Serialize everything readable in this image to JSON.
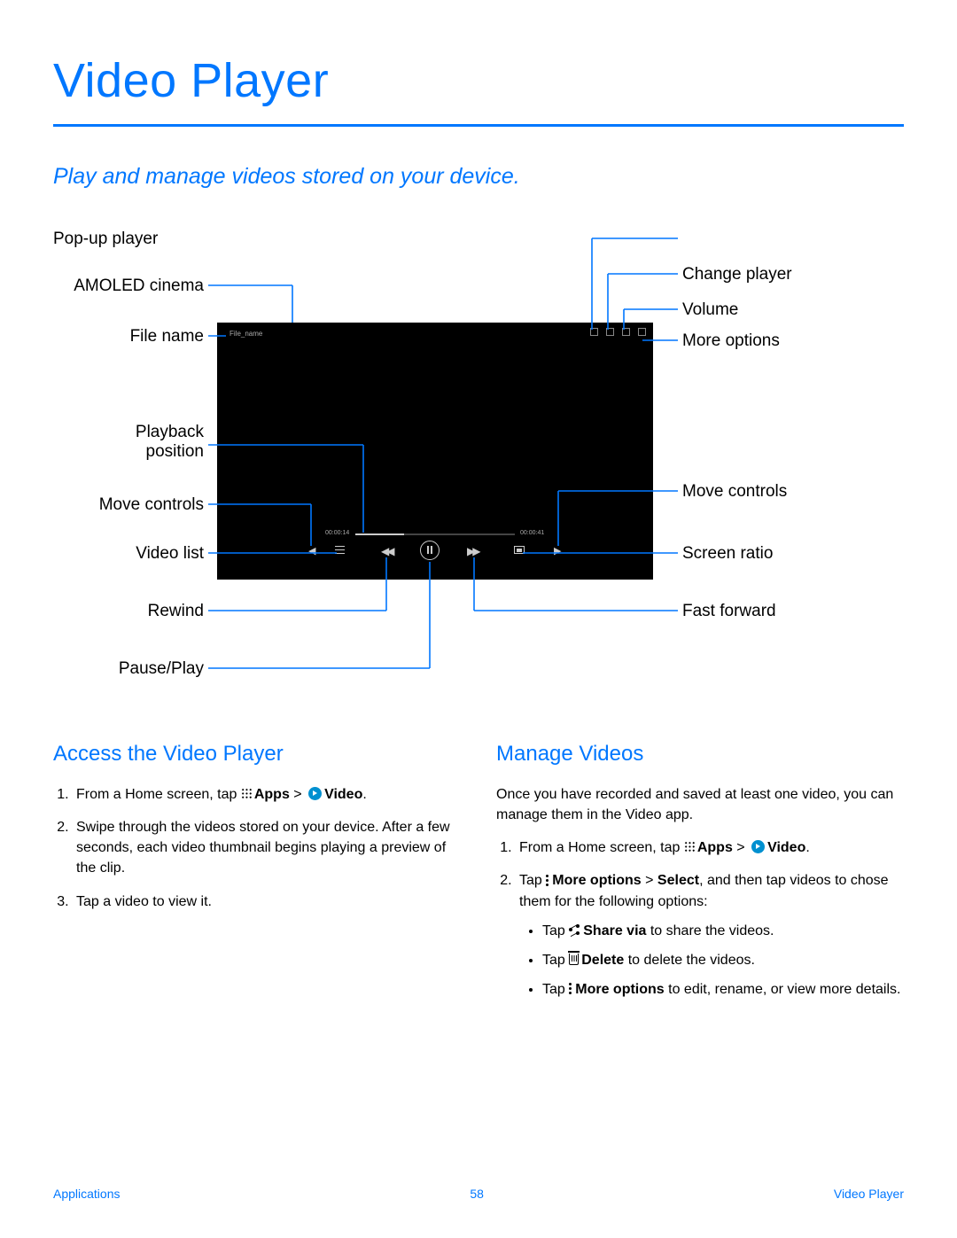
{
  "title": "Video Player",
  "subtitle": "Play and manage videos stored on your device.",
  "labels": {
    "amoled": "AMOLED cinema",
    "filename": "File name",
    "playback": "Playback\nposition",
    "move_left": "Move controls",
    "video_list": "Video list",
    "rewind": "Rewind",
    "pauseplay": "Pause/Play",
    "popup": "Pop-up player",
    "change": "Change player",
    "volume": "Volume",
    "more": "More options",
    "move_right": "Move controls",
    "ratio": "Screen ratio",
    "ffwd": "Fast forward"
  },
  "screenshot": {
    "file_label": "File_name",
    "t1": "00:00:14",
    "t2": "00:00:41"
  },
  "sections": {
    "access": {
      "heading": "Access the Video Player",
      "step1_a": "From a Home screen, tap ",
      "step1_apps": "Apps",
      "step1_gt": " > ",
      "step1_video": "Video",
      "step1_end": ".",
      "step2": "Swipe through the videos stored on your device. After a few seconds, each video thumbnail begins playing a preview of the clip.",
      "step3": "Tap a video to view it."
    },
    "manage": {
      "heading": "Manage Videos",
      "intro": "Once you have recorded and saved at least one video, you can manage them in the Video app.",
      "step1_a": "From a Home screen, tap ",
      "step1_apps": "Apps",
      "step1_gt": " > ",
      "step1_video": "Video",
      "step1_end": ".",
      "step2_a": "Tap ",
      "step2_more": "More options",
      "step2_gt": " > ",
      "step2_select": "Select",
      "step2_b": ", and then tap videos to chose them for the following options:",
      "b1_a": "Tap ",
      "b1_b": "Share via",
      "b1_c": " to share the videos.",
      "b2_a": "Tap ",
      "b2_b": "Delete",
      "b2_c": "  to delete the videos.",
      "b3_a": "Tap ",
      "b3_b": "More options",
      "b3_c": " to edit, rename, or view more details."
    }
  },
  "footer": {
    "left": "Applications",
    "center": "58",
    "right": "Video Player"
  }
}
